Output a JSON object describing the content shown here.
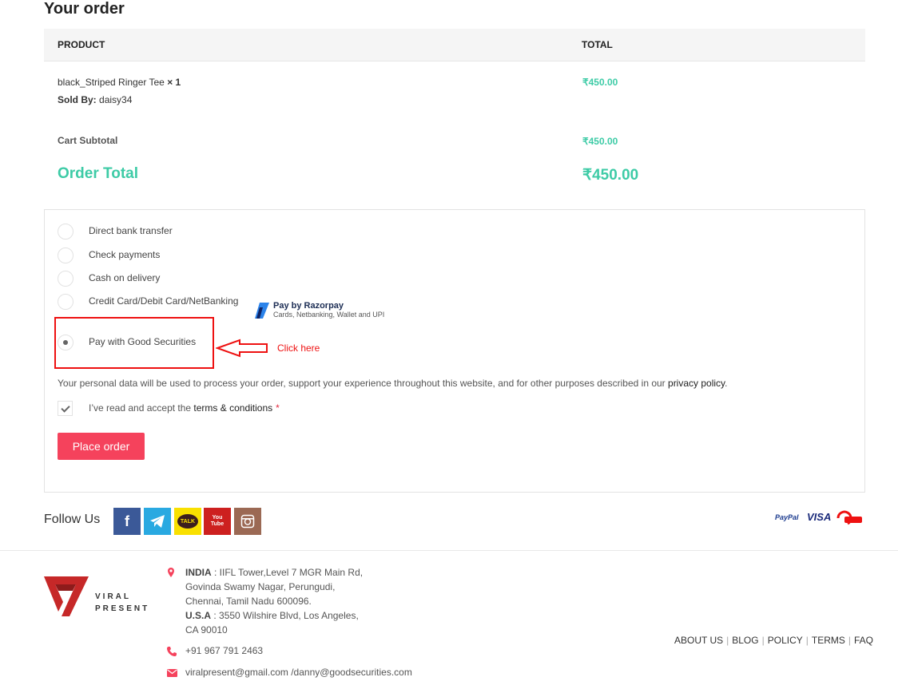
{
  "order": {
    "heading": "Your order",
    "col_product": "PRODUCT",
    "col_total": "TOTAL",
    "item": {
      "name": "black_Striped Ringer Tee",
      "qty": "× 1",
      "sold_by_label": "Sold By:",
      "seller": "daisy34",
      "price": "₹450.00"
    },
    "subtotal_label": "Cart Subtotal",
    "subtotal_value": "₹450.00",
    "total_label": "Order Total",
    "total_value": "₹450.00"
  },
  "payment": {
    "options": [
      {
        "label": "Direct bank transfer",
        "checked": false
      },
      {
        "label": "Check payments",
        "checked": false
      },
      {
        "label": "Cash on delivery",
        "checked": false
      },
      {
        "label": "Credit Card/Debit Card/NetBanking",
        "checked": false
      },
      {
        "label": "Pay with Good Securities",
        "checked": true
      }
    ],
    "razorpay_title": "Pay by Razorpay",
    "razorpay_subtitle": "Cards, Netbanking, Wallet and UPI",
    "annotation": "Click here",
    "privacy_text": "Your personal data will be used to process your order, support your experience throughout this website, and for other purposes described in our ",
    "privacy_link": "privacy policy",
    "privacy_end": ".",
    "terms_text": "I’ve read and accept the ",
    "terms_link": "terms & conditions",
    "terms_required": "*",
    "terms_checked": true,
    "place_order_label": "Place order"
  },
  "footer": {
    "follow_us": "Follow Us",
    "social": [
      {
        "name": "facebook",
        "glyph": "f"
      },
      {
        "name": "telegram"
      },
      {
        "name": "kakaotalk",
        "glyph": "TALK"
      },
      {
        "name": "youtube",
        "glyph": "You Tube"
      },
      {
        "name": "instagram"
      }
    ],
    "payment_logos": {
      "paypal": "PayPal",
      "visa": "VISA"
    },
    "brand": {
      "line1": "VIRAL",
      "line2": "PRESENT"
    },
    "address": {
      "india_label": "INDIA",
      "india_line1": " : IIFL Tower,Level 7 MGR Main Rd,",
      "india_line2": "Govinda Swamy Nagar, Perungudi,",
      "india_line3": "Chennai, Tamil Nadu 600096.",
      "usa_label": "U.S.A",
      "usa_line1": " : 3550 Wilshire Blvd, Los Angeles,",
      "usa_line2": "CA 90010"
    },
    "phone": "+91 967 791 2463",
    "email": "viralpresent@gmail.com /danny@goodsecurities.com",
    "links": [
      "ABOUT US",
      "BLOG",
      "POLICY",
      "TERMS",
      "FAQ"
    ]
  },
  "colors": {
    "accent_green": "#3dcba6",
    "button_red": "#f5425c",
    "annotation_red": "#ee1111"
  }
}
